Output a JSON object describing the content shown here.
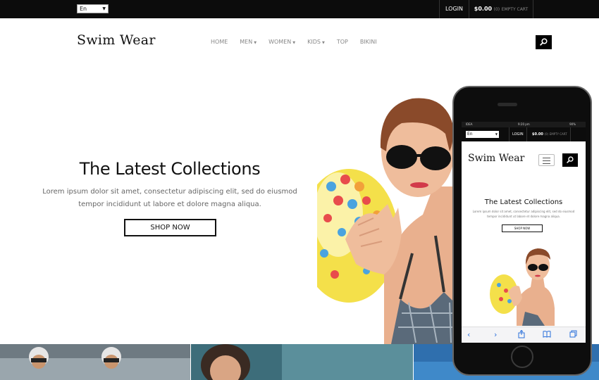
{
  "topbar": {
    "language": "En",
    "login": "LOGIN",
    "cart_amount": "$0.00",
    "cart_count": "(0)",
    "cart_empty": "EMPTY CART"
  },
  "header": {
    "logo": "Swim Wear",
    "nav": [
      {
        "label": "HOME",
        "dropdown": false
      },
      {
        "label": "MEN",
        "dropdown": true
      },
      {
        "label": "WOMEN",
        "dropdown": true
      },
      {
        "label": "KIDS",
        "dropdown": true
      },
      {
        "label": "TOP",
        "dropdown": false
      },
      {
        "label": "BIKINI",
        "dropdown": false
      }
    ],
    "search_icon": "search-icon"
  },
  "hero": {
    "title": "The Latest Collections",
    "text": "Lorem ipsum dolor sit amet, consectetur adipiscing elit, sed do eiusmod tempor incididunt ut labore et dolore magna aliqua.",
    "button": "SHOP NOW"
  },
  "phone": {
    "status_carrier": "IDEA",
    "status_time": "9:20 pm",
    "status_battery": "90%",
    "language": "En",
    "login": "LOGIN",
    "cart_amount": "$0.00",
    "cart_count": "(0)",
    "cart_empty": "EMPTY CART",
    "logo": "Swim Wear",
    "title": "The Latest Collections",
    "text": "Lorem ipsum dolor sit amet, consectetur adipiscing elit, sed do eiusmod tempor incididunt ut labore et dolore magna aliqua.",
    "button": "SHOP NOW",
    "toolbar_icons": [
      "back-icon",
      "forward-icon",
      "share-icon",
      "bookmarks-icon",
      "tabs-icon"
    ]
  },
  "colors": {
    "topbar_bg": "#0c0c0c",
    "nav_text": "#888888",
    "safari_blue": "#2a6fdb"
  }
}
